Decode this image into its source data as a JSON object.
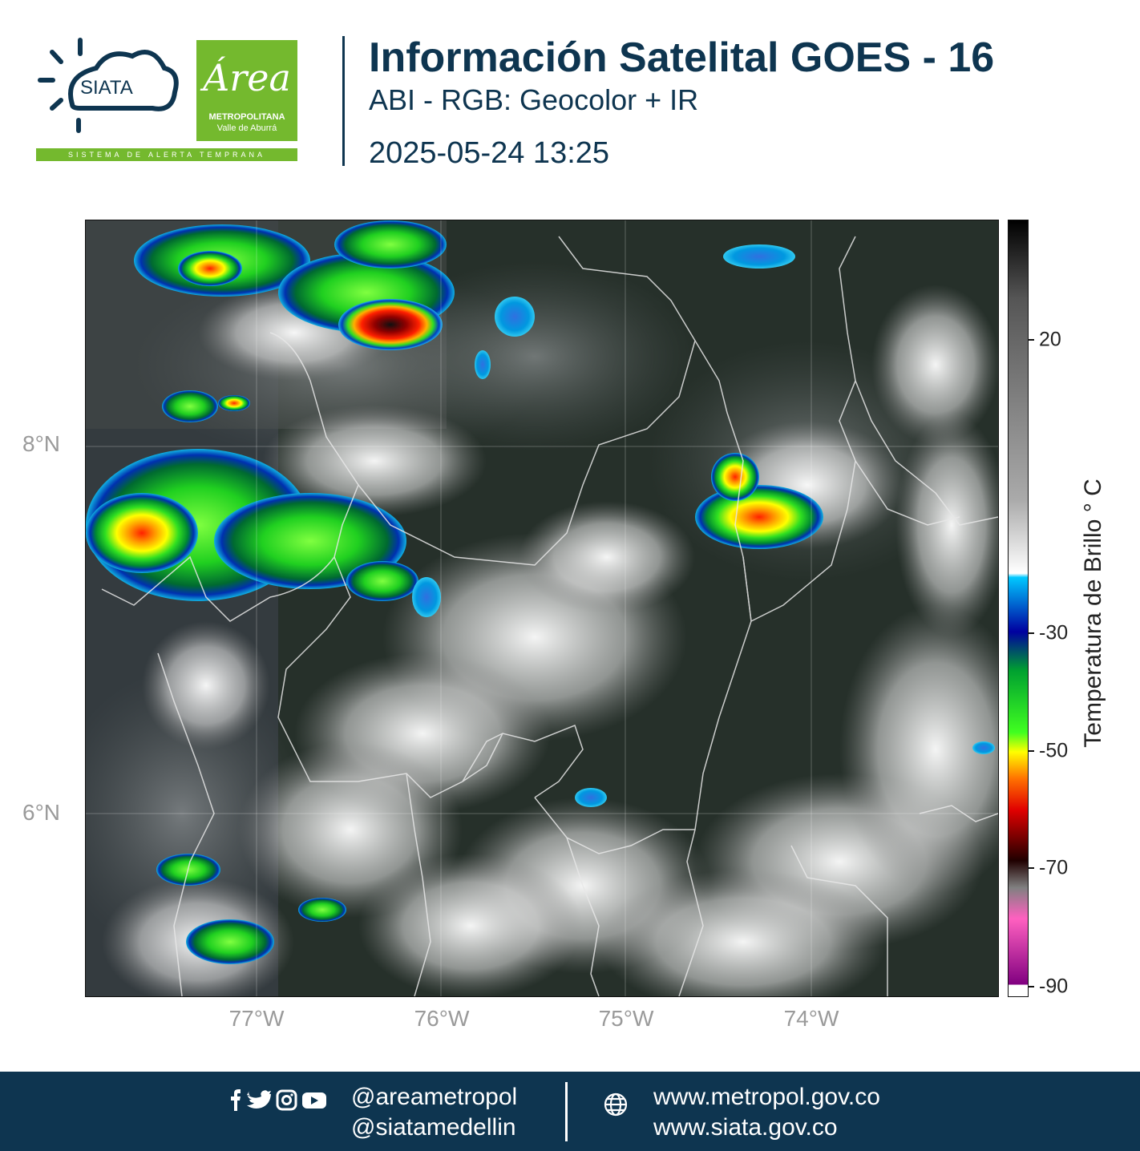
{
  "header": {
    "logo_siata": "SIATA",
    "logo_siata_tagline": "SISTEMA DE ALERTA TEMPRANA",
    "logo_area_script": "Área",
    "logo_area_line1": "METROPOLITANA",
    "logo_area_line2": "Valle de Aburrá",
    "title": "Información Satelital GOES - 16",
    "subtitle": "ABI - RGB: Geocolor + IR",
    "datetime": "2025-05-24 13:25"
  },
  "map": {
    "latitude_labels": [
      "8°N",
      "6°N"
    ],
    "longitude_labels": [
      "77°W",
      "76°W",
      "75°W",
      "74°W"
    ]
  },
  "colorbar": {
    "title": "Temperatura de Brillo ° C",
    "ticks": [
      "20",
      "-30",
      "-50",
      "-70",
      "-90"
    ],
    "colors": [
      "#000000",
      "#555555",
      "#aaaaaa",
      "#ffffff",
      "#00c8ff",
      "#0000a0",
      "#00a030",
      "#40ff20",
      "#ffff00",
      "#ff7000",
      "#e00000",
      "#200000",
      "#808080",
      "#ff60c0",
      "#800080"
    ]
  },
  "footer": {
    "icons": [
      "facebook-icon",
      "twitter-icon",
      "instagram-icon",
      "youtube-icon",
      "globe-icon"
    ],
    "handle_1": "@areametropol",
    "handle_2": "@siatamedellin",
    "website_1": "www.metropol.gov.co",
    "website_2": "www.siata.gov.co"
  }
}
